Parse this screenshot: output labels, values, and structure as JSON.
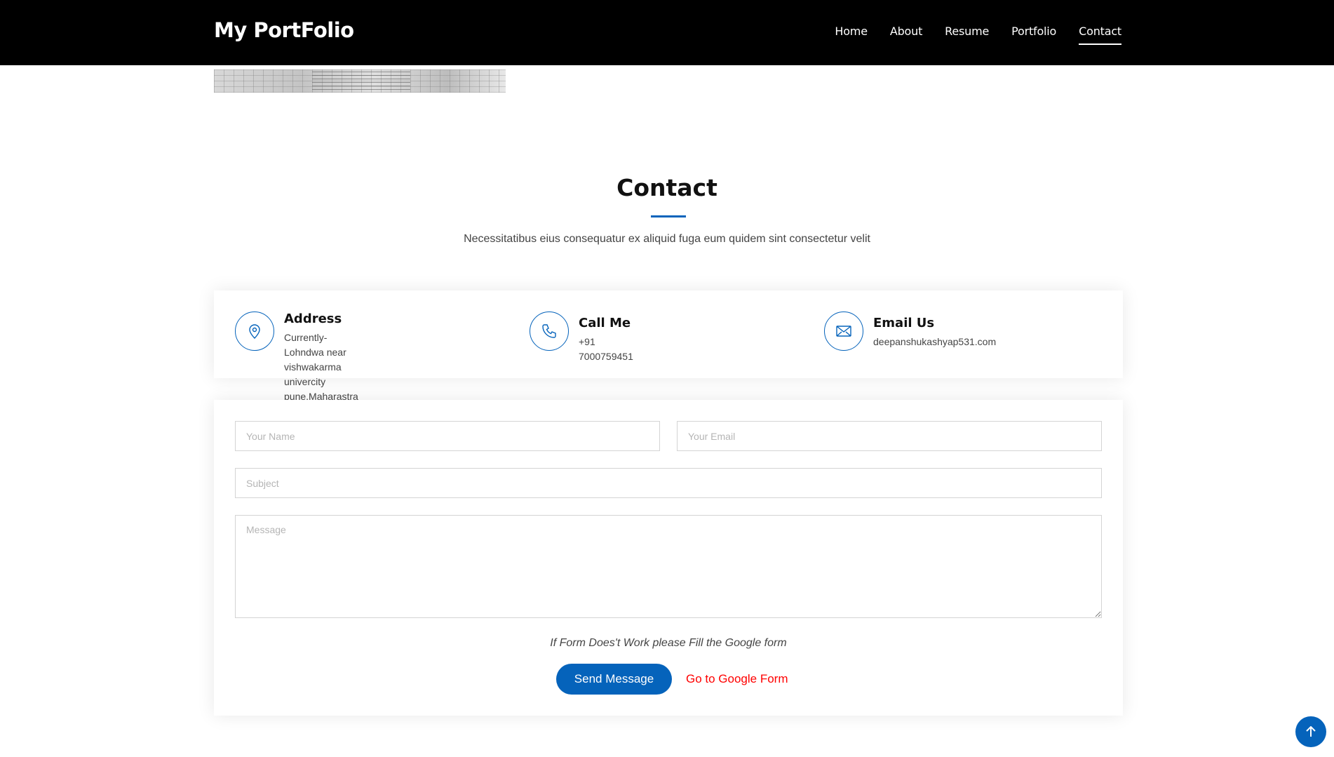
{
  "header": {
    "logo": "My PortFolio",
    "nav": [
      {
        "label": "Home",
        "active": false
      },
      {
        "label": "About",
        "active": false
      },
      {
        "label": "Resume",
        "active": false
      },
      {
        "label": "Portfolio",
        "active": false
      },
      {
        "label": "Contact",
        "active": true
      }
    ]
  },
  "section": {
    "title": "Contact",
    "subtitle": "Necessitatibus eius consequatur ex aliquid fuga eum quidem sint consectetur velit"
  },
  "info": {
    "address": {
      "title": "Address",
      "line1": "Currently-Lohndwa near vishwakarma univercity",
      "line2": "pune,Maharastra",
      "icon": "map-pin-icon"
    },
    "call": {
      "title": "Call Me",
      "text": "+91 7000759451",
      "icon": "phone-icon"
    },
    "email": {
      "title": "Email Us",
      "text": "deepanshukashyap531.com",
      "icon": "envelope-icon"
    }
  },
  "form": {
    "name_placeholder": "Your Name",
    "email_placeholder": "Your Email",
    "subject_placeholder": "Subject",
    "message_placeholder": "Message",
    "note": "If Form Does't Work please Fill the Google form",
    "send_label": "Send Message",
    "google_label": "Go to Google Form"
  },
  "colors": {
    "accent": "#0563bb",
    "header_bg": "#000000",
    "link_red": "#ff0000"
  },
  "back_to_top_icon": "arrow-up-icon"
}
